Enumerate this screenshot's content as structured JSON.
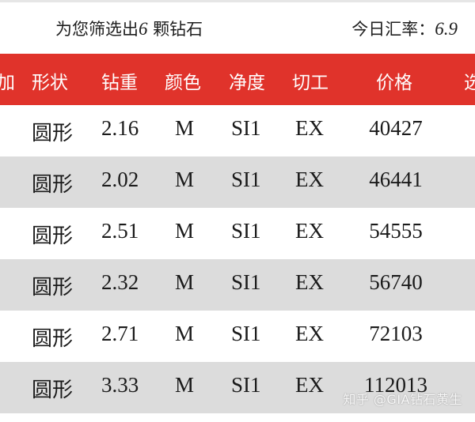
{
  "summary": {
    "prefix": "为您筛选出",
    "count": "6",
    "suffix": " 颗钻石",
    "rate_label": "今日汇率：",
    "rate_value": "6.9"
  },
  "colors": {
    "header_bg": "#e0332b",
    "row_alt_bg": "#dcdcdc",
    "row_bg": "#ffffff"
  },
  "table": {
    "headers": {
      "partial_left": "加",
      "shape": "形状",
      "carat": "钻重",
      "color": "颜色",
      "clarity": "净度",
      "cut": "切工",
      "price": "价格",
      "partial_right": "选"
    },
    "rows": [
      {
        "shape": "圆形",
        "carat": "2.16",
        "color": "M",
        "clarity": "SI1",
        "cut": "EX",
        "price": "40427"
      },
      {
        "shape": "圆形",
        "carat": "2.02",
        "color": "M",
        "clarity": "SI1",
        "cut": "EX",
        "price": "46441"
      },
      {
        "shape": "圆形",
        "carat": "2.51",
        "color": "M",
        "clarity": "SI1",
        "cut": "EX",
        "price": "54555"
      },
      {
        "shape": "圆形",
        "carat": "2.32",
        "color": "M",
        "clarity": "SI1",
        "cut": "EX",
        "price": "56740"
      },
      {
        "shape": "圆形",
        "carat": "2.71",
        "color": "M",
        "clarity": "SI1",
        "cut": "EX",
        "price": "72103"
      },
      {
        "shape": "圆形",
        "carat": "3.33",
        "color": "M",
        "clarity": "SI1",
        "cut": "EX",
        "price": "112013"
      }
    ]
  },
  "watermark": "知乎 @GIA钻石黄生"
}
